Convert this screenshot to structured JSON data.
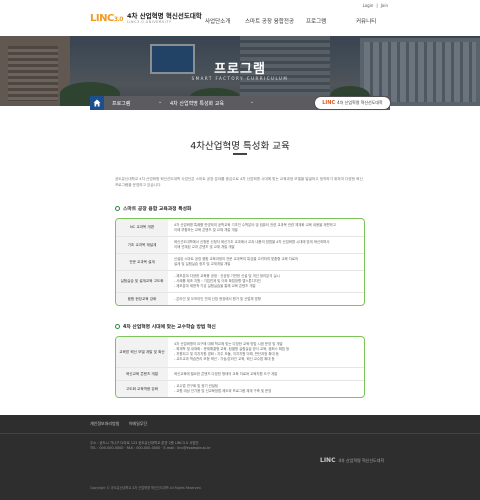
{
  "header": {
    "logo_mark": "LINC",
    "logo_mark_plus": "3.0",
    "logo_title": "4차 산업혁명 혁신선도대학",
    "logo_sub": "LINC3.0 UNIVERSITY",
    "util": [
      "Login",
      "Join"
    ],
    "nav": [
      "사업단소개",
      "스마트 공장 융합전공",
      "프로그램",
      "커뮤니티"
    ]
  },
  "hero": {
    "title": "프로그램",
    "subtitle": "SMART FACTORY CURRICULUM"
  },
  "location": {
    "crumb1": "프로그램",
    "crumb2": "4차 산업혁명 특성화 교육",
    "badge_mark": "LINC",
    "badge_text": "4차 산업혁명 혁신선도대학"
  },
  "page": {
    "title": "4차산업혁명 특성화 교육",
    "intro": "공도유닌대학교 4차 산업혁명 혁신선도대학 사업단은 스마트 공장 분야를 중심으로 4차 산업혁명 시대에 맞는 교육과정 모델을 발굴하고 정착하기 위하여 다양한 혁신 프로그램을 운영하고 있습니다."
  },
  "section1": {
    "title": "스마트 공장 융합 교육과정 특성화",
    "rows": [
      {
        "head": "NC 교과목 개편",
        "lines": [
          "4차 산업혁명 특례를 반영하여 공학교육 기초인 수학분야 및 컴퓨터 관련 교과목 관련 체계화 교육 내용을 재편하고",
          "이에 부합하는 교육 콘텐츠 및 교재 개발 개발"
        ]
      },
      {
        "head": "기초 교과목 재설계",
        "lines": [
          "혁신선도대학에서 신청한 신청자 혁신기초 교과에서 교과 내용의 방법을 4차 산업혁명 시대에 맞게 혁신하며서",
          "이에 연계된 교과 콘텐츠 및 교재 개발 개발"
        ]
      },
      {
        "head": "전문 교과목 설계",
        "lines": [
          "신설된 스마트 공장 융합 교육과정의 전문 교과목의 특성을 고려하여 맞춤형 교육 자료의",
          "설계 및 실험실습 정지 및 교재개발 개발"
        ]
      },
      {
        "head": "실험실습 및 설계교육 고도화",
        "lines": [
          "- 제조분야 다양한 교육용 공정 · 신공정 기반한 신설 및 개선 정리분석 실시",
          "- 사례를 제조 지원 : 기업연계 및 이와 확립방향 캡스톤디자인",
          "- 제조분야 제한적 기성 실험실습을 통해 교육 콘텐츠 개발"
        ]
      },
      {
        "head": "융합 현장교육 강화",
        "lines": [
          "- 온라인 및 오프라인 연계 산업 현장에서 원거 및 산업체 방향"
        ]
      }
    ]
  },
  "section2": {
    "title": "4차 산업혁명 시대에 맞는 교수학습 방법 혁신",
    "rows": [
      {
        "head": "교육방 혁신 모델 개발 및 확산",
        "lines": [
          "4차 산업혁명의 요구에 대해 학교에 맞는 다양한 교육 방법 시범 운영 및 개발",
          "- 혁재학 및 내재화 : 문제해결형 교육, 팀별형 실험실습 방식 교육, 캠퍼스 확립 등",
          "- 지원되고 및 지지지원 경화 : 자주 모듈, 지지지원 이해, 판단과정 확대 등",
          "- 교도교과 학습관리 모형 혁신 : 가상/온라인 교육, 혁신 교수법 확대 등"
        ]
      },
      {
        "head": "혁신교육 콘텐츠 개발",
        "lines": [
          "혁신교육에 필요한 콘텐츠 다양한 형태의 교육 자료와 교육지원 도구 개발"
        ]
      },
      {
        "head": "고도화 교육역량 강화",
        "lines": [
          "- 교수법 연구회 및 정기 컨설팅",
          "- 교원 대상 인기용 및 신교육방법 제도와 프로그램 체계 구축 및 운영"
        ]
      }
    ]
  },
  "footer": {
    "links": [
      "개인정보처리방침",
      "이메일무단"
    ],
    "address": [
      "주소 : 공도시 가나구 다라로 123 공도유닌대학교 본관 2층 LINC3.0 사업단",
      "TEL : 000-000-0000 · FAX : 000-000-0000 · E-mail : linc@example.ac.kr"
    ],
    "copyright": "Copyright © 공도유닌대학교 4차 산업혁명 혁신선도대학 All Rights Reserved.",
    "logo_mark": "LINC",
    "logo_text": "4차 산업혁명 혁신선도대학"
  }
}
